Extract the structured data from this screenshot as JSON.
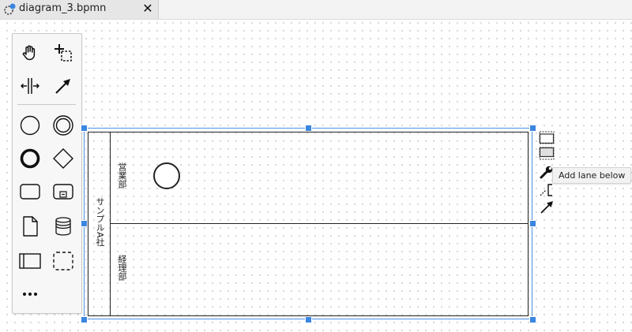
{
  "tab": {
    "title": "diagram_3.bpmn",
    "close_symbol": "✕",
    "icon": "bpmn-file-icon"
  },
  "palette": {
    "tools": [
      {
        "name": "hand-tool",
        "icon": "hand-icon"
      },
      {
        "name": "lasso-tool",
        "icon": "lasso-icon"
      },
      {
        "name": "space-tool",
        "icon": "space-icon"
      },
      {
        "name": "global-connect-tool",
        "icon": "connect-arrow-icon"
      },
      {
        "name": "create-start-event",
        "icon": "start-event-icon"
      },
      {
        "name": "create-intermediate-event",
        "icon": "intermediate-event-icon"
      },
      {
        "name": "create-end-event",
        "icon": "end-event-icon"
      },
      {
        "name": "create-gateway",
        "icon": "gateway-icon"
      },
      {
        "name": "create-task",
        "icon": "task-icon"
      },
      {
        "name": "create-subprocess",
        "icon": "subprocess-icon"
      },
      {
        "name": "create-data-object",
        "icon": "data-object-icon"
      },
      {
        "name": "create-data-store",
        "icon": "data-store-icon"
      },
      {
        "name": "create-pool",
        "icon": "pool-icon"
      },
      {
        "name": "create-group",
        "icon": "group-icon"
      }
    ],
    "more": "more-icon"
  },
  "pool": {
    "name": "サンプルA社",
    "lanes": [
      "営業部",
      "経理部"
    ]
  },
  "context_pad": {
    "actions": [
      "add-lane-above-icon",
      "add-lane-below-icon",
      "wrench-icon",
      "delete-icon",
      "text-annotation-icon",
      "connect-icon"
    ],
    "tooltip": "Add lane below"
  },
  "colors": {
    "selection": "#4a90e2",
    "stroke": "#222222",
    "tab_active": "#e6e6e6"
  }
}
